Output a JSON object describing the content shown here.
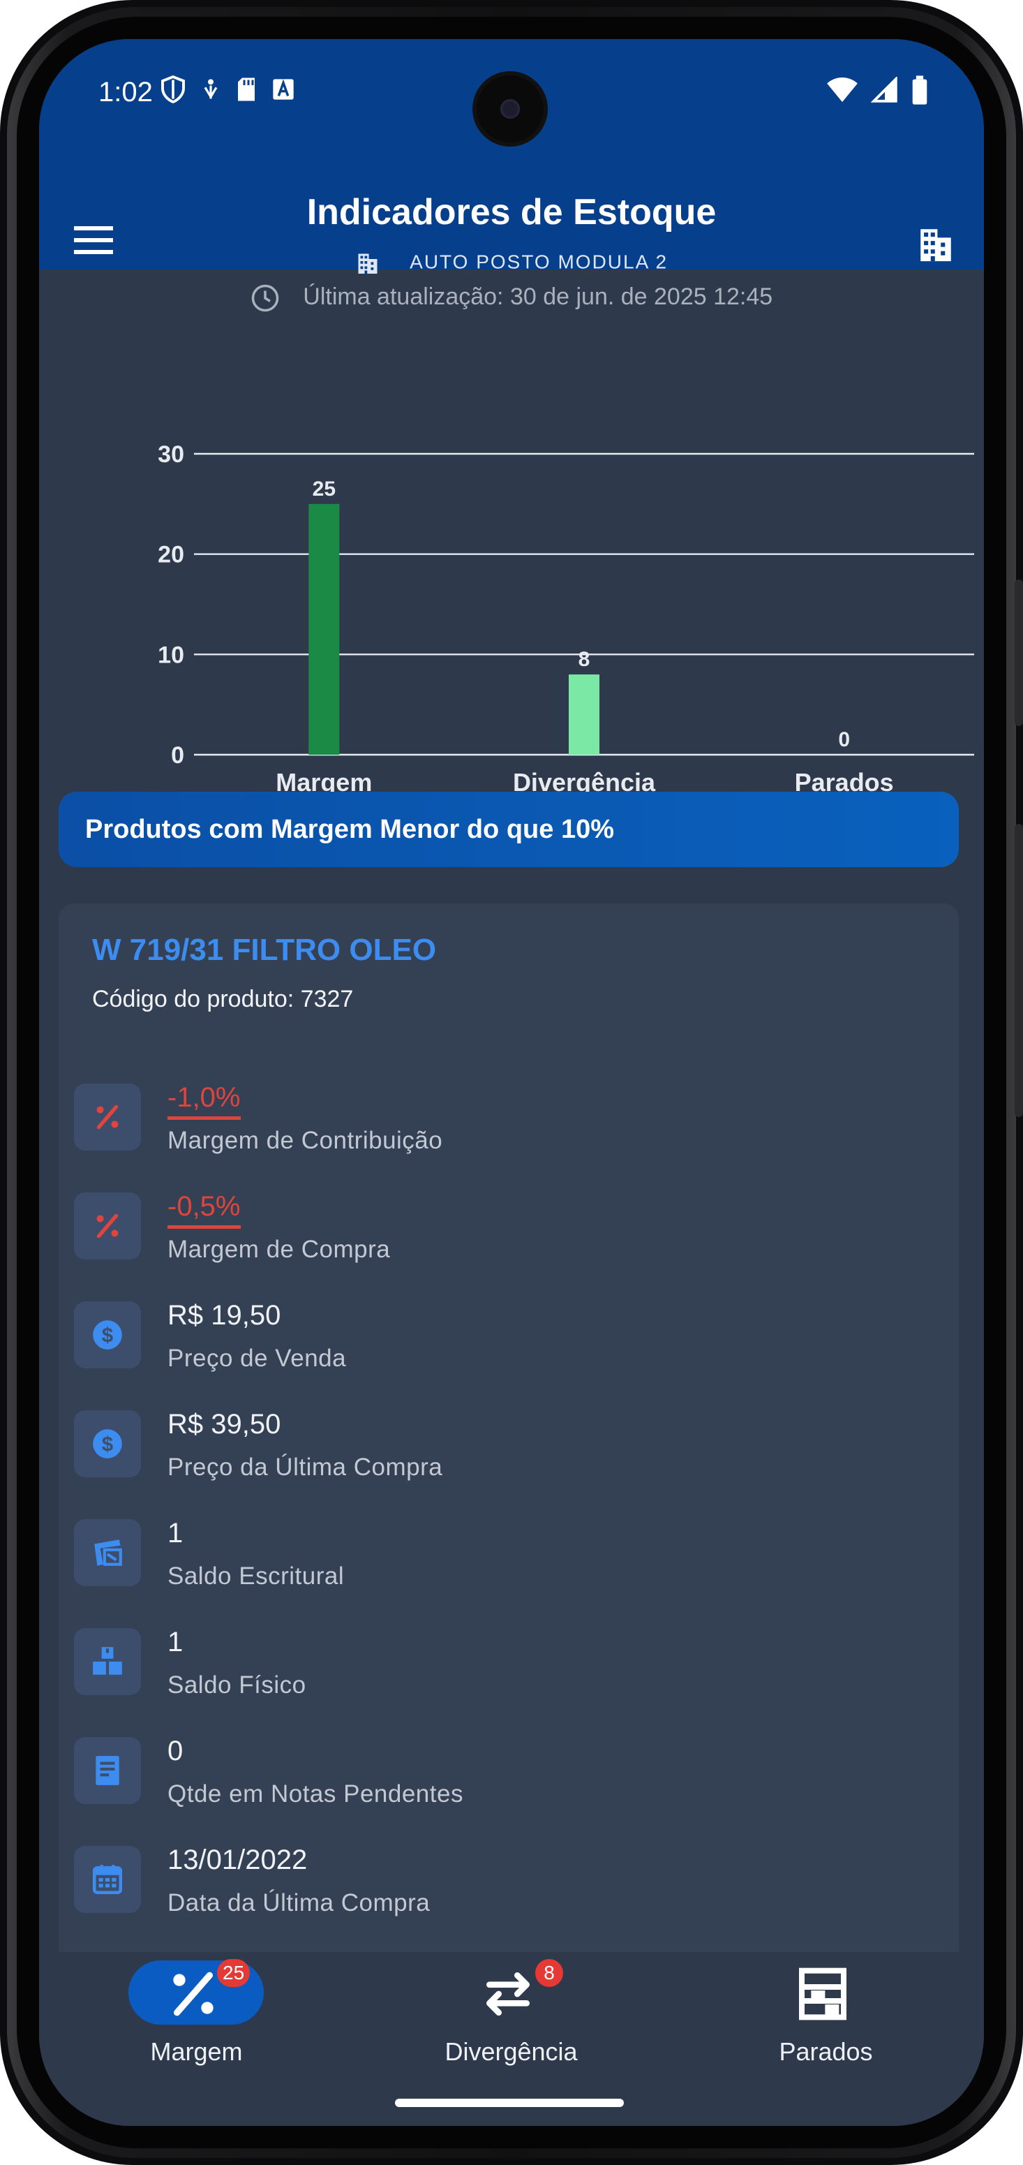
{
  "status_bar": {
    "time": "1:02"
  },
  "app_bar": {
    "title": "Indicadores de Estoque",
    "company": "AUTO POSTO MODULA 2"
  },
  "last_update": "Última atualização: 30 de jun. de 2025 12:45",
  "chart_data": {
    "type": "bar",
    "categories": [
      "Margem",
      "Divergência",
      "Parados"
    ],
    "values": [
      25,
      8,
      0
    ],
    "colors": [
      "#1b8a45",
      "#7ce8a6",
      "#7ce8a6"
    ],
    "ylim": [
      0,
      30
    ],
    "yticks": [
      0,
      10,
      20,
      30
    ],
    "grid": true,
    "title": "",
    "xlabel": "",
    "ylabel": ""
  },
  "section_title": "Produtos com Margem Menor do que 10%",
  "product": {
    "name": "W 719/31 FILTRO OLEO",
    "code": "Código do produto: 7327",
    "rows": [
      {
        "icon": "percent-icon",
        "value": "-1,0%",
        "label": "Margem de Contribuição",
        "negative": true
      },
      {
        "icon": "percent-icon",
        "value": "-0,5%",
        "label": "Margem de Compra",
        "negative": true
      },
      {
        "icon": "dollar-icon",
        "value": "R$ 19,50",
        "label": "Preço de Venda",
        "negative": false
      },
      {
        "icon": "dollar-icon",
        "value": "R$ 39,50",
        "label": "Preço da Última Compra",
        "negative": false
      },
      {
        "icon": "ledger-icon",
        "value": "1",
        "label": "Saldo Escritural",
        "negative": false
      },
      {
        "icon": "boxes-icon",
        "value": "1",
        "label": "Saldo Físico",
        "negative": false
      },
      {
        "icon": "receipt-icon",
        "value": "0",
        "label": "Qtde em Notas Pendentes",
        "negative": false
      },
      {
        "icon": "calendar-icon",
        "value": "13/01/2022",
        "label": "Data da Última Compra",
        "negative": false
      }
    ]
  },
  "bottom_nav": [
    {
      "label": "Margem",
      "badge": "25",
      "icon": "percent-icon",
      "active": true
    },
    {
      "label": "Divergência",
      "badge": "8",
      "icon": "swap-arrows-icon",
      "active": false
    },
    {
      "label": "Parados",
      "badge": "",
      "icon": "shelf-icon",
      "active": false
    }
  ],
  "colors": {
    "appbar": "#063f8b",
    "background": "#2e3a4c",
    "card": "#344155",
    "accent": "#3d8cf0",
    "negative": "#e0453d"
  }
}
